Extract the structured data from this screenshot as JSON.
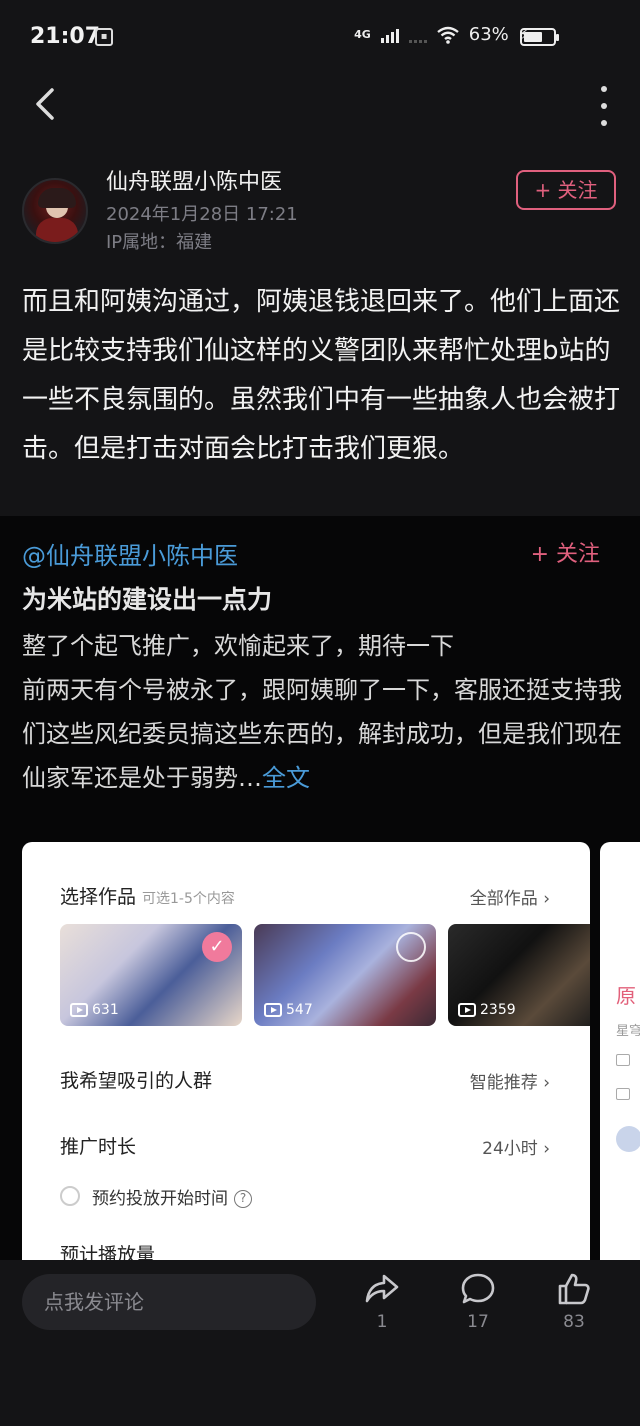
{
  "status_bar": {
    "time": "21:07",
    "network": "4G",
    "battery_text": "63%",
    "battery_level": 0.63
  },
  "post": {
    "author": "仙舟联盟小陈中医",
    "date": "2024年1月28日 17:21",
    "ip": "IP属地：福建",
    "follow_label": "+ 关注",
    "body": "而且和阿姨沟通过，阿姨退钱退回来了。他们上面还是比较支持我们仙这样的义警团队来帮忙处理b站的一些不良氛围的。虽然我们中有一些抽象人也会被打击。但是打击对面会比打击我们更狠。"
  },
  "repost": {
    "author": "@仙舟联盟小陈中医",
    "follow_label": "+ 关注",
    "title": "为米站的建设出一点力",
    "text_line1": "整了个起飞推广，欢愉起来了，期待一下",
    "text_line2": "前两天有个号被永了，跟阿姨聊了一下，客服还挺支持我们这些风纪委员搞这些东西的，解封成功，但是我们现在仙家军还是处于弱势…",
    "more_label": "全文"
  },
  "promo_screenshot": {
    "select_works_label": "选择作品",
    "select_hint": "可选1-5个内容",
    "all_works_label": "全部作品 ›",
    "thumbnails": [
      {
        "plays": "631",
        "selected": true
      },
      {
        "plays": "547",
        "selected": false
      },
      {
        "plays": "2359",
        "selected": false
      }
    ],
    "audience_label": "我希望吸引的人群",
    "audience_value": "智能推荐 ›",
    "duration_label": "推广时长",
    "duration_value": "24小时 ›",
    "schedule_label": "预约投放开始时间",
    "cut_label": "预计播放量"
  },
  "peek_card": {
    "title_fragment": "原",
    "sub_fragment": "星穹"
  },
  "bottom_bar": {
    "comment_placeholder": "点我发评论",
    "share_count": "1",
    "comment_count": "17",
    "like_count": "83"
  }
}
